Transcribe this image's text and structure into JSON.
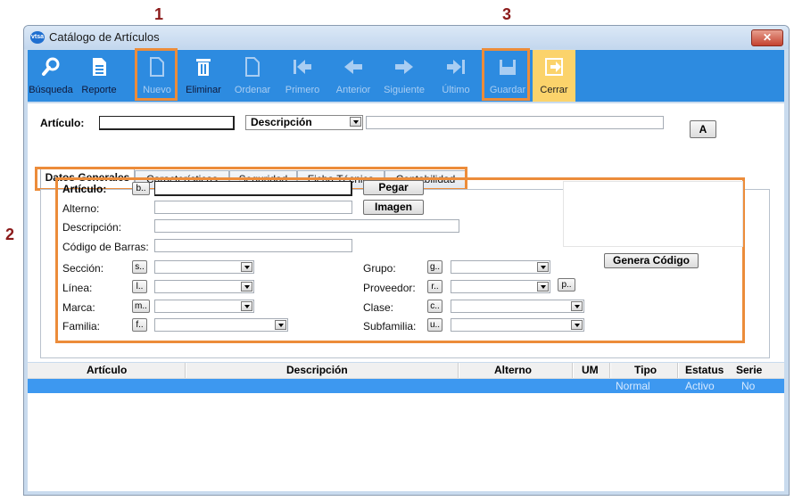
{
  "callouts": [
    "1",
    "2",
    "3"
  ],
  "window": {
    "title": "Catálogo de Artículos",
    "icon_text": "vtsa",
    "close_glyph": "✕"
  },
  "toolbar": {
    "busqueda": "Búsqueda",
    "reporte": "Reporte",
    "nuevo": "Nuevo",
    "eliminar": "Eliminar",
    "ordenar": "Ordenar",
    "primero": "Primero",
    "anterior": "Anterior",
    "siguiente": "Siguiente",
    "ultimo": "Último",
    "guardar": "Guardar",
    "cerrar": "Cerrar"
  },
  "header": {
    "articulo_label": "Artículo:",
    "descripcion_label": "Descripción",
    "a_button": "A"
  },
  "tabs": [
    "Datos Generales",
    "Características",
    "Seguridad",
    "Ficha Técnica",
    "Contabilidad"
  ],
  "form": {
    "articulo": "Artículo:",
    "alterno": "Alterno:",
    "descripcion": "Descripción:",
    "codigo_barras": "Código de Barras:",
    "seccion": "Sección:",
    "linea": "Línea:",
    "marca": "Marca:",
    "familia": "Familia:",
    "grupo": "Grupo:",
    "proveedor": "Proveedor:",
    "clase": "Clase:",
    "subfamilia": "Subfamilia:",
    "pegar": "Pegar",
    "imagen": "Imagen",
    "genera_codigo": "Genera Código",
    "btn_b": "b..",
    "btn_s": "s..",
    "btn_l": "l..",
    "btn_m": "m..",
    "btn_f": "f..",
    "btn_g": "g..",
    "btn_r": "r..",
    "btn_p": "p..",
    "btn_c": "c..",
    "btn_u": "u.."
  },
  "grid": {
    "columns": [
      "Artículo",
      "Descripción",
      "Alterno",
      "UM",
      "Tipo",
      "Estatus",
      "Serie"
    ],
    "rows": [
      {
        "tipo": "Normal",
        "estatus": "Activo",
        "serie": "No"
      }
    ]
  },
  "colors": {
    "toolbar_bg": "#2d8be0",
    "highlight": "#ec8c3a",
    "cerrar_bg": "#fbd36b",
    "selected_row": "#3d98f0"
  }
}
